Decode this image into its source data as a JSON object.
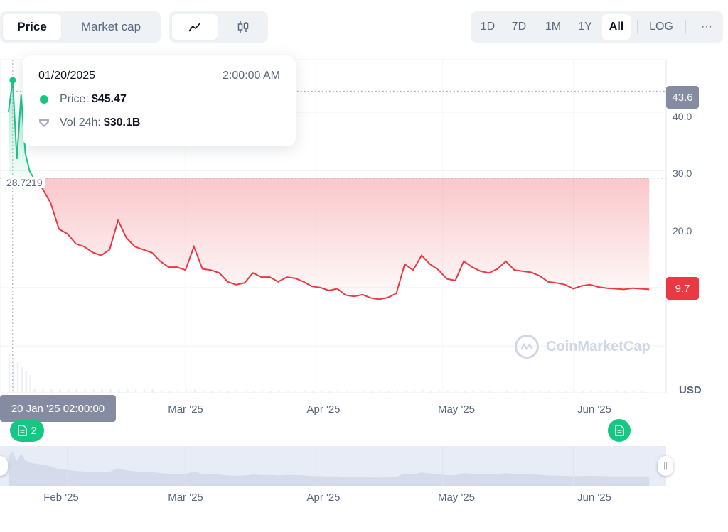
{
  "metric_tabs": [
    {
      "label": "Price",
      "active": true
    },
    {
      "label": "Market cap",
      "active": false
    }
  ],
  "chart_type_icons": [
    {
      "icon": "line-chart-icon",
      "active": true
    },
    {
      "icon": "candlestick-icon",
      "active": false
    }
  ],
  "range_tabs": [
    {
      "label": "1D",
      "active": false
    },
    {
      "label": "7D",
      "active": false
    },
    {
      "label": "1M",
      "active": false
    },
    {
      "label": "1Y",
      "active": false
    },
    {
      "label": "All",
      "active": true
    },
    {
      "label": "LOG",
      "active": false
    },
    {
      "label": "···",
      "active": false
    }
  ],
  "tooltip": {
    "date": "01/20/2025",
    "time": "2:00:00 AM",
    "price_label": "Price:",
    "price_value": "$45.47",
    "vol_label": "Vol 24h:",
    "vol_value": "$30.1B"
  },
  "colors": {
    "up": "#16c784",
    "down": "#ea3943",
    "axis_text": "#58667e",
    "hover_badge": "#858ca2"
  },
  "hover_price_badge": "43.6",
  "current_price_badge": "9.7",
  "baseline_label": "28.7219",
  "hover_time_badge": "20 Jan '25 02:00:00",
  "news_markers": [
    {
      "label": "2",
      "icon": "document-icon"
    },
    {
      "label": "",
      "icon": "document-icon"
    }
  ],
  "watermark": "CoinMarketCap",
  "unit": "USD",
  "chart_data": {
    "type": "area",
    "title": "",
    "xlabel": "",
    "ylabel": "USD",
    "y_ticks": [
      40.0,
      30.0,
      20.0
    ],
    "y_tick_labels": [
      "40.0",
      "30.0",
      "20.0"
    ],
    "ylim": [
      -8,
      49
    ],
    "x_tick_labels": [
      "Mar '25",
      "Apr '25",
      "May '25",
      "Jun '25"
    ],
    "x_tick_dates": [
      "2025-03-01",
      "2025-04-01",
      "2025-05-01",
      "2025-06-01"
    ],
    "navigator_tick_labels": [
      "Feb '25",
      "Mar '25",
      "Apr '25",
      "May '25",
      "Jun '25"
    ],
    "navigator_tick_dates": [
      "2025-02-01",
      "2025-03-01",
      "2025-04-01",
      "2025-05-01",
      "2025-06-01"
    ],
    "baseline": 28.7219,
    "grid": true,
    "series": [
      {
        "x": [
          "2025-01-18",
          "2025-01-19",
          "2025-01-20",
          "2025-01-21",
          "2025-01-22",
          "2025-01-23",
          "2025-01-24",
          "2025-01-26",
          "2025-01-28",
          "2025-01-30",
          "2025-02-01",
          "2025-02-03",
          "2025-02-05",
          "2025-02-07",
          "2025-02-09",
          "2025-02-11",
          "2025-02-13",
          "2025-02-15",
          "2025-02-17",
          "2025-02-19",
          "2025-02-21",
          "2025-02-23",
          "2025-02-25",
          "2025-02-27",
          "2025-03-01",
          "2025-03-03",
          "2025-03-05",
          "2025-03-07",
          "2025-03-09",
          "2025-03-11",
          "2025-03-13",
          "2025-03-15",
          "2025-03-17",
          "2025-03-19",
          "2025-03-21",
          "2025-03-23",
          "2025-03-25",
          "2025-03-27",
          "2025-03-29",
          "2025-03-31",
          "2025-04-02",
          "2025-04-04",
          "2025-04-06",
          "2025-04-08",
          "2025-04-10",
          "2025-04-12",
          "2025-04-14",
          "2025-04-16",
          "2025-04-18",
          "2025-04-20",
          "2025-04-22",
          "2025-04-24",
          "2025-04-26",
          "2025-04-28",
          "2025-04-30",
          "2025-05-02",
          "2025-05-04",
          "2025-05-06",
          "2025-05-08",
          "2025-05-10",
          "2025-05-12",
          "2025-05-14",
          "2025-05-16",
          "2025-05-18",
          "2025-05-20",
          "2025-05-22",
          "2025-05-24",
          "2025-05-26",
          "2025-05-28",
          "2025-05-30",
          "2025-06-01",
          "2025-06-03",
          "2025-06-05",
          "2025-06-07",
          "2025-06-09",
          "2025-06-11",
          "2025-06-13",
          "2025-06-15",
          "2025-06-17",
          "2025-06-19"
        ],
        "y": [
          40.0,
          45.47,
          32.0,
          43.0,
          33.0,
          30.0,
          28.7,
          27.0,
          24.5,
          20.0,
          19.2,
          17.5,
          17.0,
          16.0,
          15.5,
          16.5,
          21.5,
          18.5,
          17.0,
          16.5,
          16.0,
          14.5,
          13.5,
          13.5,
          13.0,
          17.0,
          13.2,
          13.0,
          12.5,
          11.0,
          10.5,
          10.8,
          12.5,
          11.8,
          11.8,
          11.0,
          11.8,
          11.6,
          11.0,
          10.2,
          10.0,
          9.5,
          9.8,
          8.7,
          8.5,
          8.8,
          8.2,
          8.0,
          8.3,
          9.0,
          14.0,
          13.0,
          15.5,
          14.0,
          13.0,
          11.5,
          11.2,
          14.5,
          13.5,
          12.8,
          12.5,
          13.2,
          14.5,
          13.0,
          12.8,
          12.6,
          12.0,
          11.0,
          10.8,
          10.5,
          9.8,
          10.3,
          10.5,
          10.1,
          9.9,
          9.8,
          9.7,
          9.9,
          9.8,
          9.7
        ]
      }
    ]
  }
}
